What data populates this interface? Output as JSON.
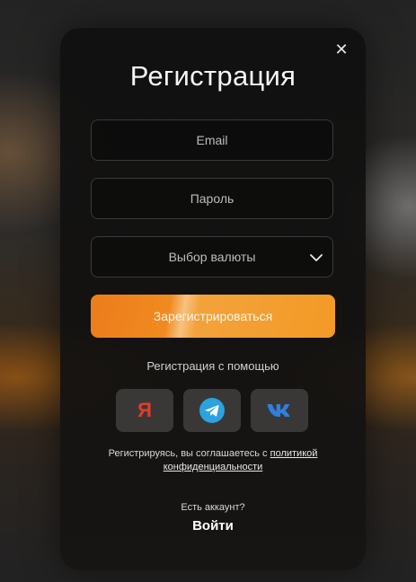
{
  "modal": {
    "title": "Регистрация",
    "close_icon": "close-icon",
    "email_placeholder": "Email",
    "password_placeholder": "Пароль",
    "currency_select_label": "Выбор валюты",
    "register_button_label": "Зарегистрироваться",
    "social_caption": "Регистрация с помощью",
    "social_buttons": [
      {
        "name": "yandex",
        "icon": "yandex-icon",
        "glyph": "Я",
        "color": "#e53b2c"
      },
      {
        "name": "telegram",
        "icon": "telegram-icon",
        "color": "#2aa3e0"
      },
      {
        "name": "vk",
        "icon": "vk-icon",
        "color": "#2f7fe0"
      }
    ],
    "consent_text": "Регистрируясь, вы соглашаетесь с ",
    "consent_link": "политикой конфиденциальности",
    "have_account_text": "Есть аккаунт?",
    "login_label": "Войти"
  },
  "colors": {
    "accent": "#f08a1f",
    "modal_background": "#111111"
  }
}
